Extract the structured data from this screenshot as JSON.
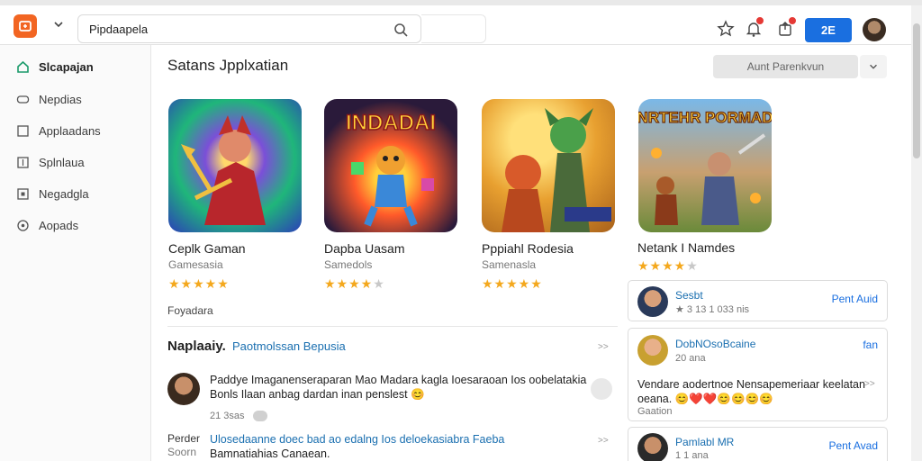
{
  "topbar": {
    "search_value": "Pipdaapela",
    "primary_button": "2E",
    "notifications_badge": "1",
    "messages_badge": "1"
  },
  "sidebar": {
    "items": [
      {
        "label": "Slcapajan",
        "icon": "home-icon",
        "active": true
      },
      {
        "label": "Nepdias",
        "icon": "controller-icon",
        "active": false
      },
      {
        "label": "Applaadans",
        "icon": "apps-icon",
        "active": false
      },
      {
        "label": "Splnlaua",
        "icon": "sparkle-icon",
        "active": false
      },
      {
        "label": "Negadgla",
        "icon": "box-icon",
        "active": false
      },
      {
        "label": "Aopads",
        "icon": "settings-icon",
        "active": false
      }
    ]
  },
  "main": {
    "title": "Satans Jpplxatian",
    "sort_label": "Aunt Parenkvun",
    "apps": [
      {
        "name": "Ceplk Gaman",
        "category": "Gamesasia",
        "rating": 5,
        "art_title": ""
      },
      {
        "name": "Dapba Uasam",
        "category": "Samedols",
        "rating": 4.5,
        "art_title": "INDADAI"
      },
      {
        "name": "Pppiahl Rodesia",
        "category": "Samenasla",
        "rating": 5,
        "art_title": ""
      },
      {
        "name": "Netank I Namdes",
        "category": "",
        "rating": 4.5,
        "art_title": "NRTEHR PORMAD"
      }
    ],
    "more_label": "Foyadara",
    "subsection": {
      "title": "Naplaaiy.",
      "link": "Paotmolssan Bepusia",
      "more": ">>"
    },
    "comments": [
      {
        "text": "Paddye Imaganenseraparan Mao Madara kagla Ioesaraoan Ios oobelatakia Bonls Ilaan anbag dardan inan penslest 😊",
        "meta": "21 3sas"
      },
      {
        "author": "Perder",
        "author2": "Soorn",
        "text_a": "Ulosedaanne doec bad ao edalng Ios",
        "text_link": "deloekasiabra Faeba",
        "text_b": "Bamnatiahias Canaean."
      }
    ]
  },
  "right_panel": {
    "title": "Netank I Namdes",
    "cards": [
      {
        "name": "Sesbt",
        "meta": "★ 3 13 1 033 nis",
        "action": "Pent Auid"
      },
      {
        "name": "DobNOsoBcaine",
        "meta": "20 ana",
        "action": "fan",
        "body": "Vendare aodertnoe Nensapemeriaar keelatan oeana. 😊❤️❤️😊😊😊😊",
        "foot": "Gaation"
      },
      {
        "name": "Pamlabl MR",
        "meta": "1 1 ana",
        "action": "Pent Avad"
      }
    ]
  },
  "colors": {
    "accent": "#1a6fe0",
    "brand": "#f26522",
    "star": "#f4a81d",
    "link": "#1a6fb0"
  }
}
